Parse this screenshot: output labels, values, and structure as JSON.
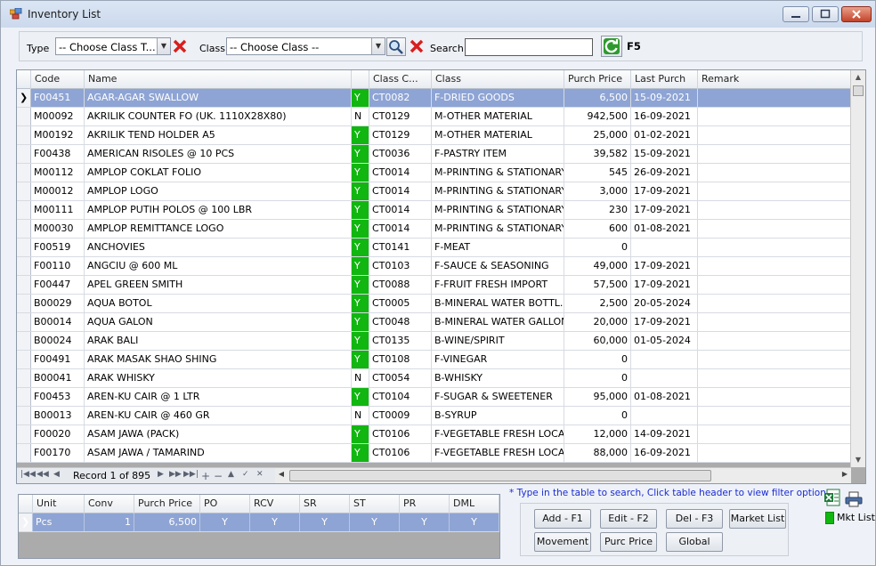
{
  "window": {
    "title": "Inventory List"
  },
  "filter": {
    "type_label": "Type",
    "type_value": "-- Choose Class T...",
    "class_label": "Class",
    "class_value": "-- Choose Class --",
    "search_label": "Search",
    "search_value": "",
    "refresh_key": "F5"
  },
  "grid": {
    "columns": [
      "Code",
      "Name",
      "",
      "Class C...",
      "Class",
      "Purch Price",
      "Last Purch",
      "Remark"
    ],
    "rows": [
      {
        "code": "F00451",
        "name": "AGAR-AGAR SWALLOW",
        "flag": "Y",
        "class_code": "CT0082",
        "class": "F-DRIED GOODS",
        "price": "6,500",
        "last": "15-09-2021",
        "remark": "",
        "selected": true
      },
      {
        "code": "M00092",
        "name": "AKRILIK COUNTER FO (UK. 1110X28X80)",
        "flag": "N",
        "class_code": "CT0129",
        "class": "M-OTHER MATERIAL",
        "price": "942,500",
        "last": "16-09-2021",
        "remark": ""
      },
      {
        "code": "M00192",
        "name": "AKRILIK TEND HOLDER A5",
        "flag": "Y",
        "class_code": "CT0129",
        "class": "M-OTHER MATERIAL",
        "price": "25,000",
        "last": "01-02-2021",
        "remark": ""
      },
      {
        "code": "F00438",
        "name": "AMERICAN RISOLES @ 10 PCS",
        "flag": "Y",
        "class_code": "CT0036",
        "class": "F-PASTRY ITEM",
        "price": "39,582",
        "last": "15-09-2021",
        "remark": ""
      },
      {
        "code": "M00112",
        "name": "AMPLOP COKLAT FOLIO",
        "flag": "Y",
        "class_code": "CT0014",
        "class": "M-PRINTING & STATIONARY",
        "price": "545",
        "last": "26-09-2021",
        "remark": ""
      },
      {
        "code": "M00012",
        "name": "AMPLOP LOGO",
        "flag": "Y",
        "class_code": "CT0014",
        "class": "M-PRINTING & STATIONARY",
        "price": "3,000",
        "last": "17-09-2021",
        "remark": ""
      },
      {
        "code": "M00111",
        "name": "AMPLOP PUTIH POLOS @ 100 LBR",
        "flag": "Y",
        "class_code": "CT0014",
        "class": "M-PRINTING & STATIONARY",
        "price": "230",
        "last": "17-09-2021",
        "remark": ""
      },
      {
        "code": "M00030",
        "name": "AMPLOP REMITTANCE LOGO",
        "flag": "Y",
        "class_code": "CT0014",
        "class": "M-PRINTING & STATIONARY",
        "price": "600",
        "last": "01-08-2021",
        "remark": ""
      },
      {
        "code": "F00519",
        "name": "ANCHOVIES",
        "flag": "Y",
        "class_code": "CT0141",
        "class": "F-MEAT",
        "price": "0",
        "last": "",
        "remark": ""
      },
      {
        "code": "F00110",
        "name": "ANGCIU @ 600  ML",
        "flag": "Y",
        "class_code": "CT0103",
        "class": "F-SAUCE & SEASONING",
        "price": "49,000",
        "last": "17-09-2021",
        "remark": ""
      },
      {
        "code": "F00447",
        "name": "APEL GREEN SMITH",
        "flag": "Y",
        "class_code": "CT0088",
        "class": "F-FRUIT FRESH IMPORT",
        "price": "57,500",
        "last": "17-09-2021",
        "remark": ""
      },
      {
        "code": "B00029",
        "name": "AQUA BOTOL",
        "flag": "Y",
        "class_code": "CT0005",
        "class": "B-MINERAL WATER BOTTL...",
        "price": "2,500",
        "last": "20-05-2024",
        "remark": ""
      },
      {
        "code": "B00014",
        "name": "AQUA GALON",
        "flag": "Y",
        "class_code": "CT0048",
        "class": "B-MINERAL WATER GALLON",
        "price": "20,000",
        "last": "17-09-2021",
        "remark": ""
      },
      {
        "code": "B00024",
        "name": "ARAK BALI",
        "flag": "Y",
        "class_code": "CT0135",
        "class": "B-WINE/SPIRIT",
        "price": "60,000",
        "last": "01-05-2024",
        "remark": ""
      },
      {
        "code": "F00491",
        "name": "ARAK MASAK SHAO SHING",
        "flag": "Y",
        "class_code": "CT0108",
        "class": "F-VINEGAR",
        "price": "0",
        "last": "",
        "remark": ""
      },
      {
        "code": "B00041",
        "name": "ARAK WHISKY",
        "flag": "N",
        "class_code": "CT0054",
        "class": "B-WHISKY",
        "price": "0",
        "last": "",
        "remark": ""
      },
      {
        "code": "F00453",
        "name": "AREN-KU CAIR @ 1 LTR",
        "flag": "Y",
        "class_code": "CT0104",
        "class": "F-SUGAR & SWEETENER",
        "price": "95,000",
        "last": "01-08-2021",
        "remark": ""
      },
      {
        "code": "B00013",
        "name": "AREN-KU CAIR @ 460 GR",
        "flag": "N",
        "class_code": "CT0009",
        "class": "B-SYRUP",
        "price": "0",
        "last": "",
        "remark": ""
      },
      {
        "code": "F00020",
        "name": "ASAM JAWA (PACK)",
        "flag": "Y",
        "class_code": "CT0106",
        "class": "F-VEGETABLE FRESH LOCAL",
        "price": "12,000",
        "last": "14-09-2021",
        "remark": ""
      },
      {
        "code": "F00170",
        "name": "ASAM JAWA / TAMARIND",
        "flag": "Y",
        "class_code": "CT0106",
        "class": "F-VEGETABLE FRESH LOCAL",
        "price": "88,000",
        "last": "16-09-2021",
        "remark": ""
      }
    ]
  },
  "navigator": {
    "record_text": "Record 1 of 895"
  },
  "units": {
    "columns": [
      "Unit",
      "Conv",
      "Purch Price",
      "PO",
      "RCV",
      "SR",
      "ST",
      "PR",
      "DML"
    ],
    "rows": [
      {
        "unit": "Pcs",
        "conv": "1",
        "price": "6,500",
        "po": "Y",
        "rcv": "Y",
        "sr": "Y",
        "st": "Y",
        "pr": "Y",
        "dml": "Y"
      }
    ]
  },
  "hint": "* Type in the table to search, Click table header to view filter options",
  "buttons": {
    "add": "Add - F1",
    "edit": "Edit - F2",
    "del": "Del - F3",
    "market_list": "Market List",
    "movement": "Movement",
    "purc_price": "Purc Price",
    "global": "Global"
  },
  "legend": {
    "mkt_list": "Mkt List",
    "color": "#11b611"
  },
  "colors": {
    "selected_row": "#8ea4d4",
    "flag_green": "#11b611",
    "hint_text": "#1c2bd0"
  }
}
